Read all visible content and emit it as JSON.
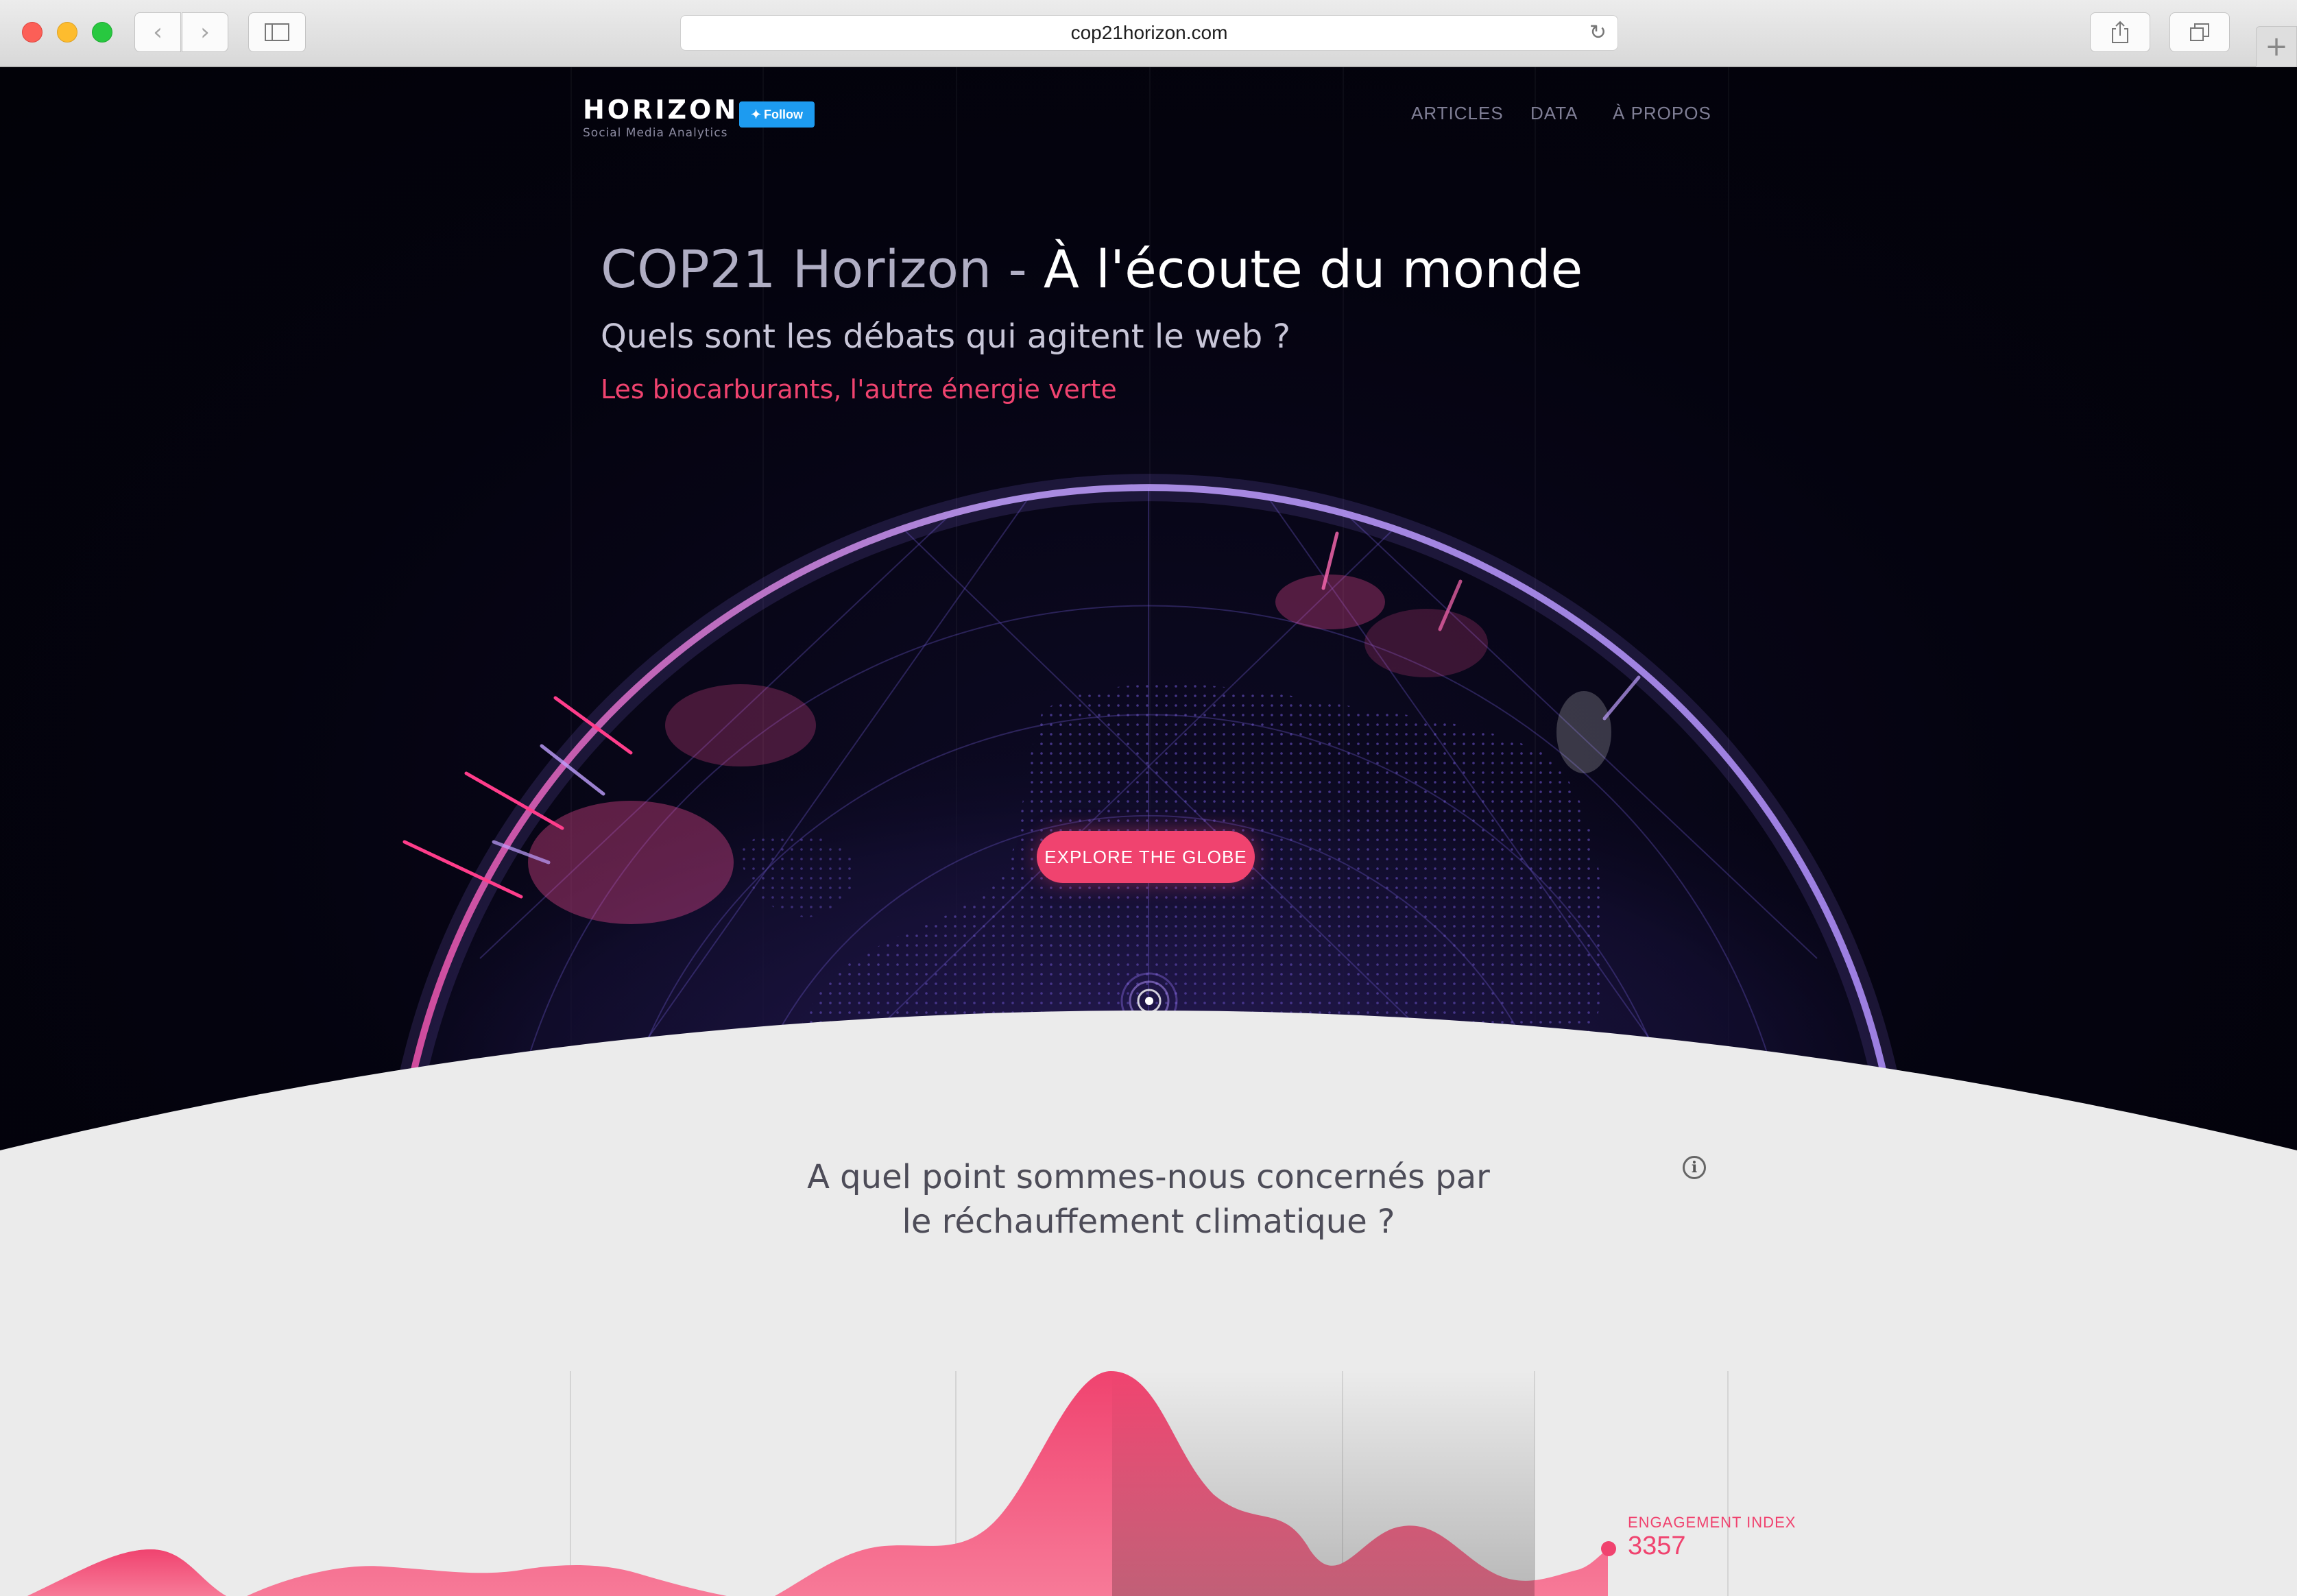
{
  "browser": {
    "url": "cop21horizon.com",
    "back_icon": "chevron-left-icon",
    "forward_icon": "chevron-right-icon",
    "sidebar_icon": "sidebar-icon",
    "reload_icon": "reload-icon",
    "share_icon": "share-icon",
    "tabs_icon": "tabs-icon",
    "new_tab_icon": "plus-icon"
  },
  "header": {
    "logo": "HORIZON",
    "logo_sub": "Social Media Analytics",
    "follow_label": "Follow",
    "nav": [
      "ARTICLES",
      "DATA",
      "À PROPOS"
    ]
  },
  "hero": {
    "title_main": "COP21 Horizon",
    "title_sep": " - ",
    "title_em": "À l'écoute du monde",
    "subtitle": "Quels sont les débats qui agitent le web ?",
    "tagline": "Les biocarburants, l'autre énergie verte",
    "cta": "EXPLORE THE GLOBE"
  },
  "section": {
    "question": "A quel point sommes-nous concernés par le réchauffement climatique ?",
    "engagement_label": "ENGAGEMENT INDEX",
    "engagement_value": "3357"
  },
  "colors": {
    "accent": "#f0436f",
    "hero_bg": "#04030f",
    "section_bg": "#ebebeb",
    "globe": "#8f6bff"
  }
}
